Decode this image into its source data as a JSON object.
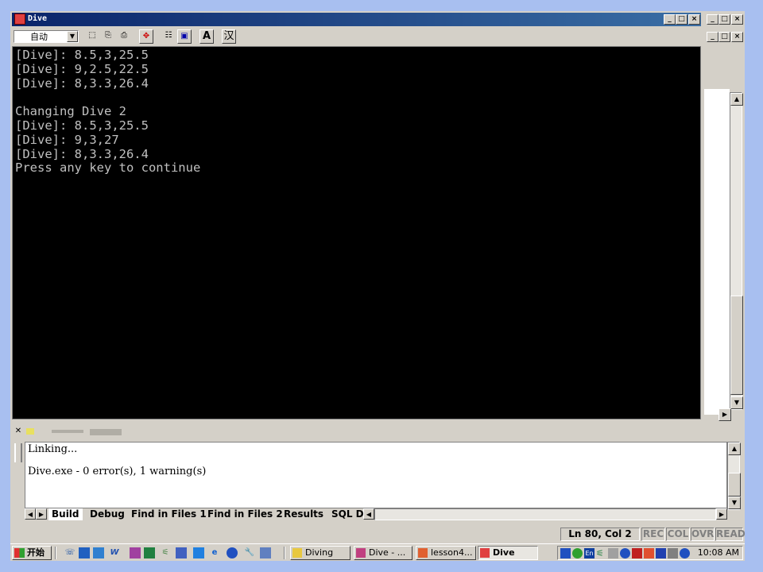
{
  "window": {
    "title": "Dive",
    "buttons": [
      "_",
      "□",
      "×"
    ]
  },
  "mdi_buttons": [
    "_",
    "□",
    "×"
  ],
  "console_toolbar": {
    "font_select_value": "自动",
    "buttons": [
      {
        "name": "mark-icon",
        "glyph": "⬚"
      },
      {
        "name": "copy-icon",
        "glyph": "⎘"
      },
      {
        "name": "paste-icon",
        "glyph": "⎙"
      },
      {
        "name": "fullscreen-icon",
        "glyph": "✥"
      },
      {
        "name": "properties-icon",
        "glyph": "☷"
      },
      {
        "name": "background-icon",
        "glyph": "▣"
      },
      {
        "name": "font-icon",
        "glyph": "A"
      },
      {
        "name": "chinese-ime-icon",
        "glyph": "汉"
      }
    ]
  },
  "console": {
    "text": "[Dive]: 8.5,3,25.5\n[Dive]: 9,2.5,22.5\n[Dive]: 8,3.3,26.4\n\nChanging Dive 2\n[Dive]: 8.5,3,25.5\n[Dive]: 9,3,27\n[Dive]: 8,3.3,26.4\nPress any key to continue"
  },
  "output": {
    "lines": "Linking...\n\nDive.exe - 0 error(s), 1 warning(s)",
    "tabs": [
      "Build",
      "Debug",
      "Find in Files 1",
      "Find in Files 2",
      "Results",
      "SQL D"
    ]
  },
  "status": {
    "position": "Ln 80, Col 2",
    "indicators": [
      "REC",
      "COL",
      "OVR",
      "READ"
    ]
  },
  "taskbar": {
    "start_label": "开始",
    "tasks": [
      "Diving",
      "Dive - ...",
      "lesson4...",
      "Dive"
    ],
    "active_task": "Dive",
    "clock": "10:08 AM"
  },
  "colors": {
    "console_bg": "#000000",
    "console_fg": "#c0c0c0",
    "titlebar": "#0a246a",
    "desktop": "#a8bff0",
    "dim_indicator": "#808080"
  }
}
